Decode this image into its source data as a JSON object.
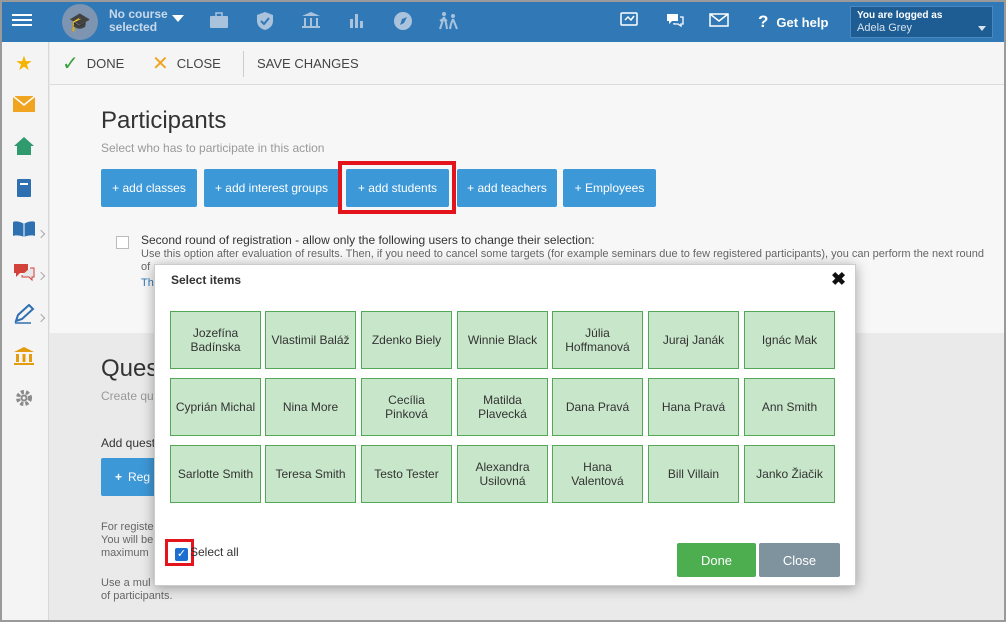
{
  "topbar": {
    "course_line1": "No course",
    "course_line2": "selected",
    "help": "Get help",
    "user_line1": "You are logged as",
    "user_line2": "Adela Grey"
  },
  "toolbar": {
    "done": "DONE",
    "close": "CLOSE",
    "save": "SAVE CHANGES"
  },
  "participants": {
    "title": "Participants",
    "subtitle": "Select who has to participate in this action",
    "buttons": [
      "+ add classes",
      "+ add interest groups",
      "+ add students",
      "+ add teachers",
      "+ Employees"
    ],
    "second_round": "Second round of registration - allow only the following users to change their selection:",
    "second_round_desc": "Use this option after evaluation of results. Then, if you need to cancel some targets (for example seminars due to few registered participants), you can perform the next round",
    "second_round_desc2": "of",
    "link_partial": "Th"
  },
  "questions": {
    "title_partial": "Ques",
    "sub_partial": "Create qu",
    "add_partial": "Add quest",
    "reg_button_partial": "Reg",
    "p1": [
      "For registe",
      "You will be",
      "maximum"
    ],
    "p2": [
      "Use a mul",
      "of participants."
    ]
  },
  "modal": {
    "title": "Select items",
    "items": [
      "Jozefína Badínska",
      "Vlastimil Baláž",
      "Zdenko Biely",
      "Winnie Black",
      "Júlia Hoffmanová",
      "Juraj Janák",
      "Ignác Mak",
      "Cyprián Michal",
      "Nina More",
      "Cecília Pinková",
      "Matilda Plavecká",
      "Dana Pravá",
      "Hana Pravá",
      "Ann Smith",
      "Sarlotte Smith",
      "Teresa Smith",
      "Testo Tester",
      "Alexandra Usilovná",
      "Hana Valentová",
      "Bill Villain",
      "Janko Žiačik"
    ],
    "select_all": "Select all",
    "select_all_checked": true,
    "done": "Done",
    "close": "Close"
  },
  "colors": {
    "topbar": "#3079b6",
    "primary_button": "#3d98d8",
    "tile_bg": "#c8e6c9",
    "tile_border": "#53a857",
    "done_button": "#4cae4f",
    "close_button": "#7f939e",
    "highlight": "#e3141b"
  }
}
